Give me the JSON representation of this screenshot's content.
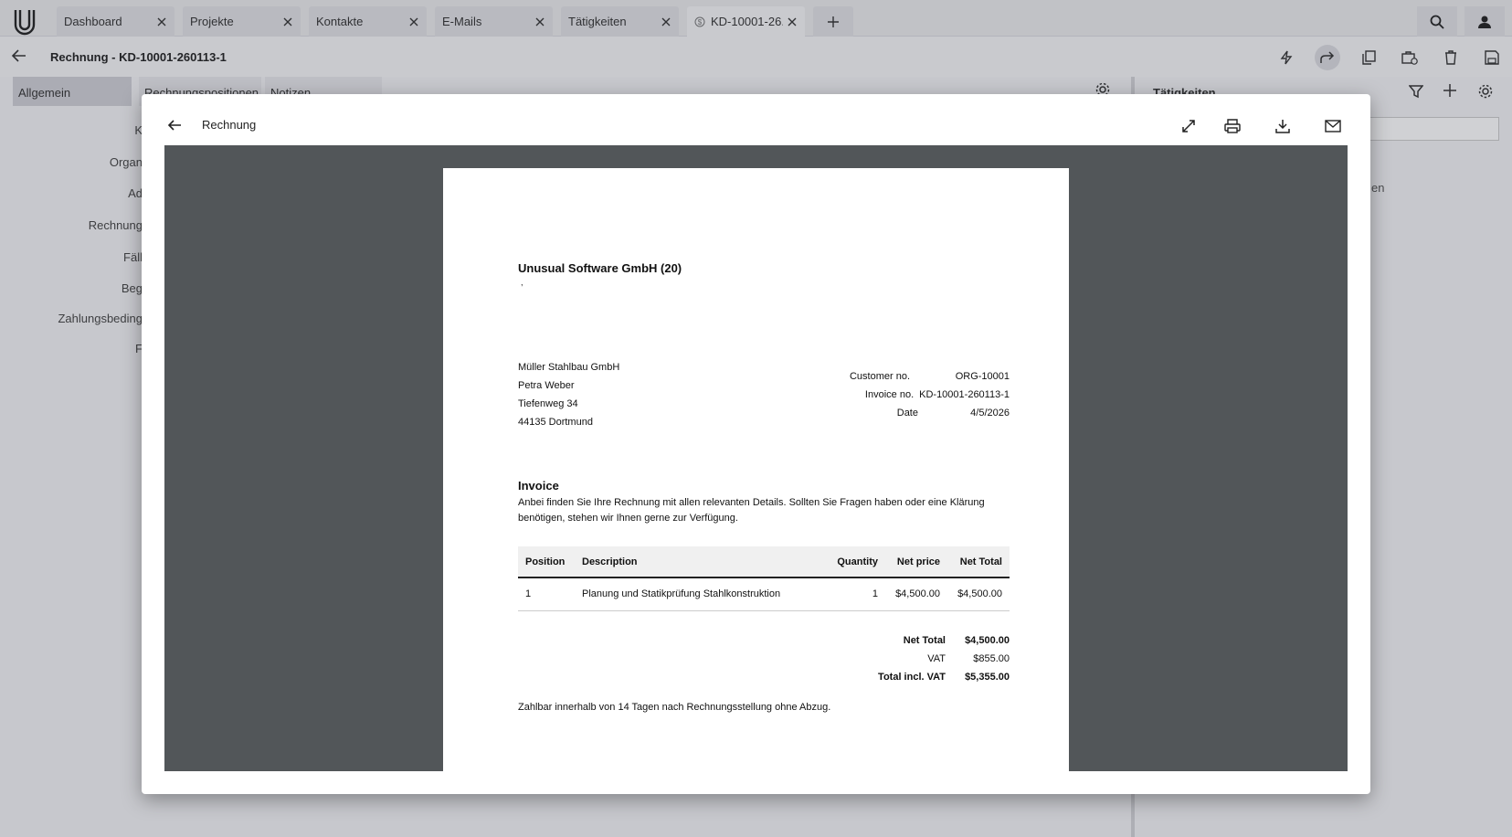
{
  "tabs": [
    {
      "label": "Dashboard"
    },
    {
      "label": "Projekte"
    },
    {
      "label": "Kontakte"
    },
    {
      "label": "E-Mails"
    },
    {
      "label": "Tätigkeiten"
    },
    {
      "label": "KD-10001-26..."
    }
  ],
  "record": {
    "title": "Rechnung - KD-10001-260113-1",
    "subtabs": [
      "Allgemein",
      "Rechnungspositionen",
      "Notizen"
    ],
    "form_labels": [
      "K",
      "Organ",
      "Ad",
      "Rechnung",
      "Fäll",
      "Beg",
      "Zahlungsbeding",
      "F"
    ]
  },
  "right_panel": {
    "title": "Tätigkeiten",
    "fragment": "en"
  },
  "dialog": {
    "title": "Rechnung"
  },
  "invoice": {
    "company": "Unusual Software GmbH (20)",
    "company_sub": ",",
    "recipient": [
      "Müller Stahlbau GmbH",
      "Petra Weber",
      "Tiefenweg 34",
      "44135 Dortmund"
    ],
    "meta": [
      {
        "label": "Customer no.",
        "value": "ORG-10001"
      },
      {
        "label": "Invoice no.",
        "value": "KD-10001-260113-1"
      },
      {
        "label": "Date",
        "value": "4/5/2026"
      }
    ],
    "heading": "Invoice",
    "intro": "Anbei finden Sie Ihre Rechnung mit allen relevanten Details. Sollten Sie Fragen haben oder eine Klärung benötigen, stehen wir Ihnen gerne zur Verfügung.",
    "columns": [
      "Position",
      "Description",
      "Quantity",
      "Net price",
      "Net Total"
    ],
    "rows": [
      {
        "position": "1",
        "description": "Planung und Statikprüfung Stahlkonstruktion",
        "quantity": "1",
        "net_price": "$4,500.00",
        "net_total": "$4,500.00"
      }
    ],
    "totals": [
      {
        "label": "Net Total",
        "value": "$4,500.00",
        "bold": true
      },
      {
        "label": "VAT",
        "value": "$855.00",
        "bold": false
      },
      {
        "label": "Total incl. VAT",
        "value": "$5,355.00",
        "bold": true
      }
    ],
    "payment_terms": "Zahlbar innerhalb von 14 Tagen nach Rechnungsstellung ohne Abzug."
  },
  "colors": {
    "viewer_bg": "#525659",
    "scrim": "rgba(40,44,60,0.22)"
  }
}
